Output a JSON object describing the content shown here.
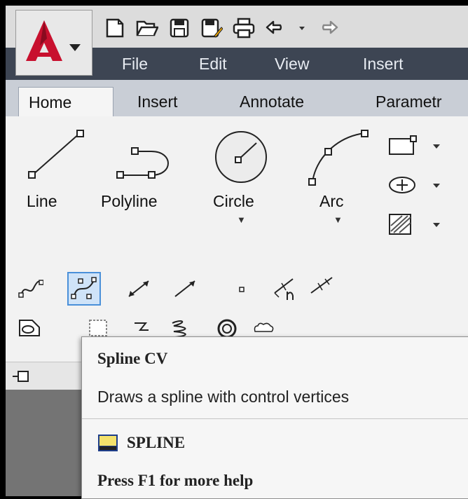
{
  "menubar": {
    "items": [
      "File",
      "Edit",
      "View",
      "Insert"
    ]
  },
  "tabs": [
    "Home",
    "Insert",
    "Annotate",
    "Parametr"
  ],
  "ribbon": {
    "draw_tools": [
      {
        "label": "Line",
        "icon": "line-icon"
      },
      {
        "label": "Polyline",
        "icon": "polyline-icon"
      },
      {
        "label": "Circle",
        "icon": "circle-icon"
      },
      {
        "label": "Arc",
        "icon": "arc-icon"
      }
    ],
    "side_tools": [
      "rectangle-icon",
      "ellipse-icon",
      "hatch-icon"
    ],
    "row1_icons": [
      "spline-fit-icon",
      "spline-cv-icon",
      "construction-line-icon",
      "ray-icon",
      "point-icon",
      "divide-icon",
      "measure-icon"
    ],
    "row2_icons": [
      "region-icon",
      "wipeout-icon",
      "3d-polyline-icon",
      "helix-icon",
      "donut-icon",
      "revision-cloud-icon"
    ]
  },
  "tooltip": {
    "title": "Spline CV",
    "description": "Draws a spline with control vertices",
    "command": "SPLINE",
    "help": "Press F1 for more help"
  },
  "colors": {
    "menubar_bg": "#3d4553",
    "autocad_red": "#c8102e",
    "highlight_blue": "#4a90d9"
  }
}
